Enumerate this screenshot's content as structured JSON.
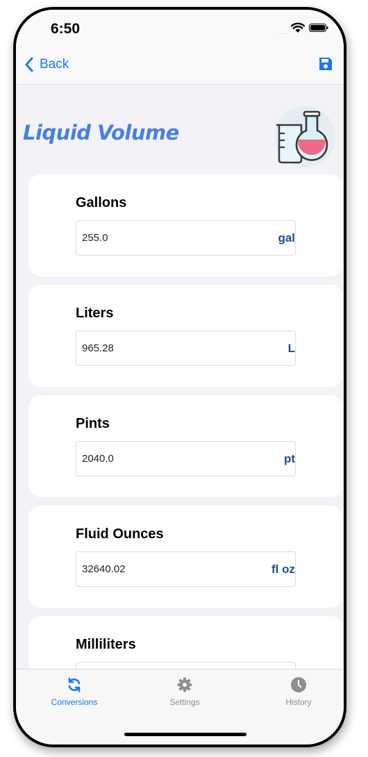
{
  "status_bar": {
    "time": "6:50",
    "signal_dots": "....",
    "wifi_icon": "wifi-icon",
    "battery_icon": "battery-icon"
  },
  "nav": {
    "back_label": "Back",
    "back_icon": "chevron-left-icon",
    "save_icon": "save-icon"
  },
  "page": {
    "title": "Liquid Volume",
    "illustration": "flask-beaker-icon"
  },
  "conversions": [
    {
      "label": "Gallons",
      "value": "255.0",
      "unit": "gal"
    },
    {
      "label": "Liters",
      "value": "965.28",
      "unit": "L"
    },
    {
      "label": "Pints",
      "value": "2040.0",
      "unit": "pt"
    },
    {
      "label": "Fluid Ounces",
      "value": "32640.02",
      "unit": "fl oz"
    },
    {
      "label": "Milliliters",
      "value": "",
      "unit": ""
    }
  ],
  "tabbar": {
    "tabs": [
      {
        "label": "Conversions",
        "icon": "refresh-icon",
        "active": true
      },
      {
        "label": "Settings",
        "icon": "gear-icon",
        "active": false
      },
      {
        "label": "History",
        "icon": "clock-icon",
        "active": false
      }
    ]
  },
  "colors": {
    "accent": "#1877f2",
    "title": "#4a7fe0",
    "unit": "#1f4f86",
    "background": "#f2f2f7"
  }
}
